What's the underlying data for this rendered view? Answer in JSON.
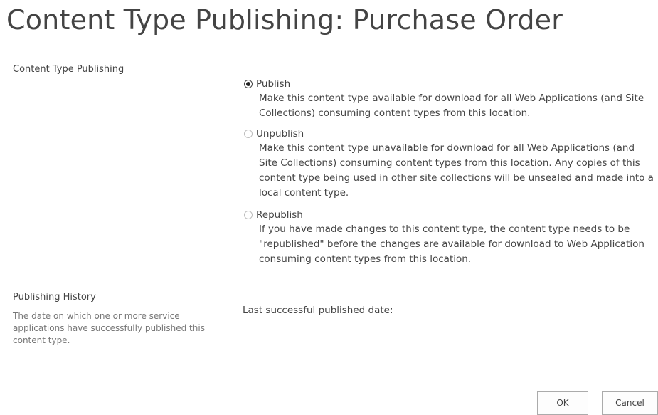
{
  "page": {
    "title": "Content Type Publishing: Purchase Order"
  },
  "publishing_section": {
    "heading": "Content Type Publishing",
    "options": [
      {
        "label": "Publish",
        "selected": true,
        "description": "Make this content type available for download for all Web Applications (and Site Collections) consuming content types from this location."
      },
      {
        "label": "Unpublish",
        "selected": false,
        "description": "Make this content type unavailable for download for all Web Applications (and Site Collections) consuming content types from this location. Any copies of this content type being used in other site collections will be unsealed and made into a local content type."
      },
      {
        "label": "Republish",
        "selected": false,
        "description": "If you have made changes to this content type, the content type needs to be \"republished\" before the changes are available for download to Web Application consuming content types from this location."
      }
    ]
  },
  "history_section": {
    "heading": "Publishing History",
    "description": "The date on which one or more service applications have successfully published this content type.",
    "last_published_label": "Last successful published date:"
  },
  "buttons": {
    "ok_label": "OK",
    "cancel_label": "Cancel"
  }
}
